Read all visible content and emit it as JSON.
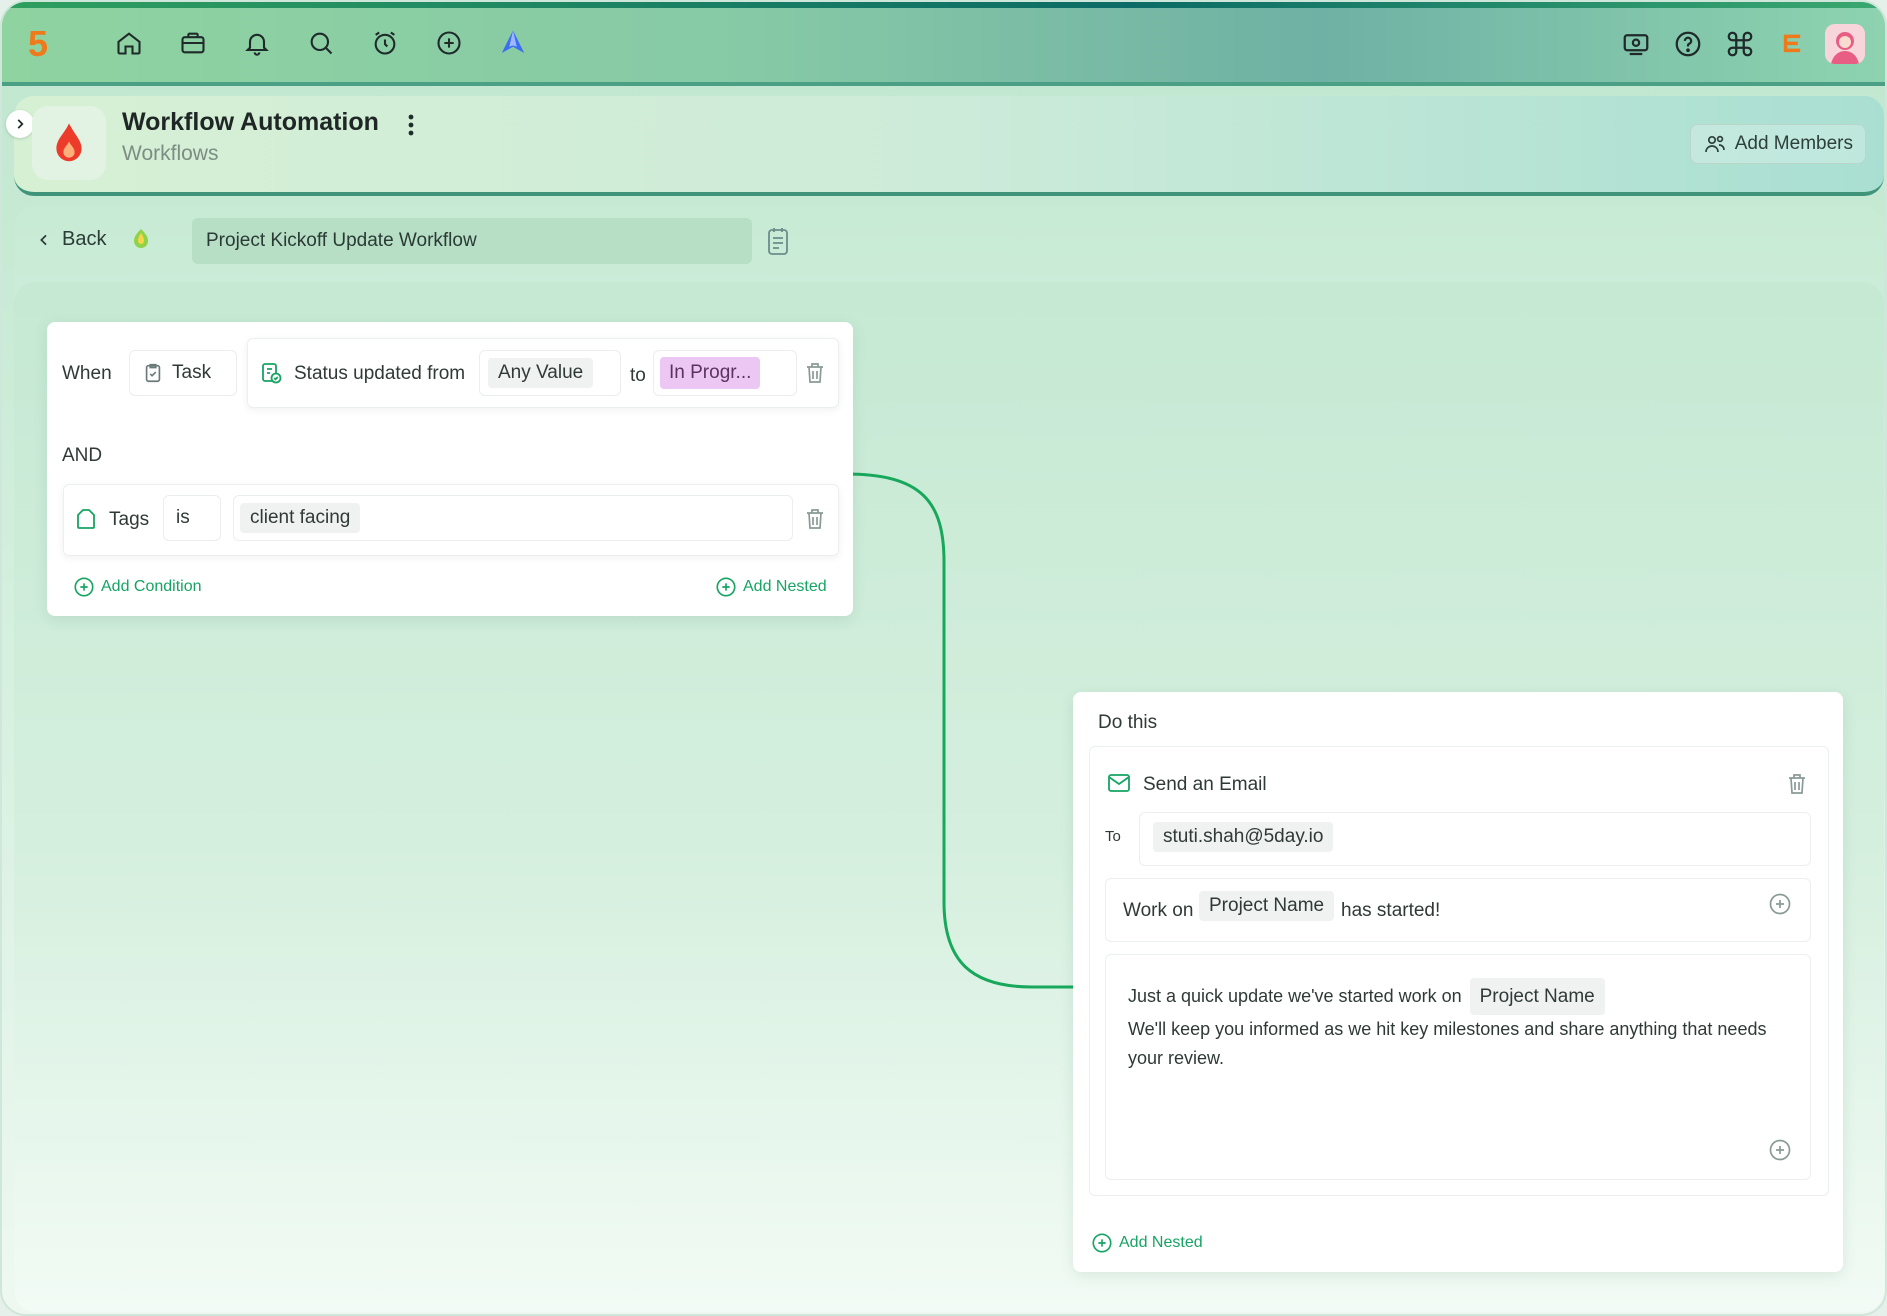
{
  "topbar": {
    "logo": "5",
    "nav_icons": [
      "home-icon",
      "briefcase-icon",
      "bell-icon",
      "search-icon",
      "alarm-icon",
      "plus-circle-icon",
      "ai-logo-icon"
    ],
    "right_icons": [
      "payments-icon",
      "help-icon",
      "command-icon",
      "brand-icon",
      "avatar"
    ]
  },
  "project": {
    "title": "Workflow Automation",
    "subtitle": "Workflows",
    "add_members_label": "Add Members"
  },
  "workflow": {
    "back_label": "Back",
    "name": "Project Kickoff Update Workflow"
  },
  "trigger": {
    "when_label": "When",
    "entity": "Task",
    "condition_text": "Status updated from",
    "from_value": "Any Value",
    "to_label": "to",
    "to_value": "In Progr...",
    "and_label": "AND",
    "tag_field": "Tags",
    "tag_operator": "is",
    "tag_value": "client facing",
    "add_condition_label": "Add Condition",
    "add_nested_label": "Add Nested"
  },
  "action": {
    "header": "Do this",
    "type": "Send an Email",
    "to_label": "To",
    "to_value": "stuti.shah@5day.io",
    "subject_prefix": "Work on",
    "subject_token": "Project Name",
    "subject_suffix": "has started!",
    "body_prefix": "Just a quick update we've started work on",
    "body_token": "Project Name",
    "body_line2": "We'll keep you informed as we hit key milestones and share anything that needs",
    "body_line3": "your review.",
    "add_nested_label": "Add Nested"
  },
  "colors": {
    "accent_green": "#16a463",
    "connector": "#17a85b",
    "status_pill": "#ecc7f3"
  }
}
